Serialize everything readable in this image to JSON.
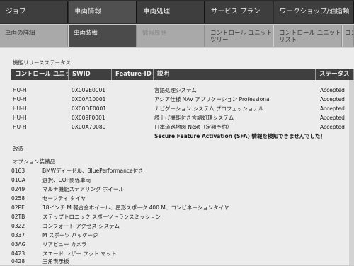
{
  "main_tabs": [
    {
      "label": "ジョブ"
    },
    {
      "label": "車両情報"
    },
    {
      "label": "車両処理"
    },
    {
      "label": "サービス プラン"
    },
    {
      "label": "ワークショップ/油脂類"
    }
  ],
  "sub_tabs": [
    {
      "label": "車両の詳細"
    },
    {
      "label": "車両装備"
    },
    {
      "label": "情報履歴"
    },
    {
      "label": "コントロール ユニット ツリー"
    },
    {
      "label": "コントロール ユニット リスト"
    },
    {
      "label": "コン"
    }
  ],
  "release_section": {
    "title": "機能リリースステータス"
  },
  "table": {
    "headers": {
      "unit": "コントロール ユニット",
      "swid": "SWID",
      "feature_id": "Feature-ID",
      "description": "説明",
      "status": "ステータス"
    },
    "rows": [
      {
        "unit": "HU-H",
        "swid": "0X009E0001",
        "description": "言語処理システム",
        "status": "Accepted"
      },
      {
        "unit": "HU-H",
        "swid": "0X00A10001",
        "description": "アジア仕様 NAV アプリケーション Professional",
        "status": "Accepted"
      },
      {
        "unit": "HU-H",
        "swid": "0X00DE0001",
        "description": "ナビゲーション システム プロフェッショナル",
        "status": "Accepted"
      },
      {
        "unit": "HU-H",
        "swid": "0X009F0001",
        "description": "読上げ機能付き言語処理システム",
        "status": "Accepted"
      },
      {
        "unit": "HU-H",
        "swid": "0X00A70080",
        "description": "日本道路地図 Next（定期予約）",
        "status": "Accepted"
      }
    ],
    "note": "Secure Feature Activation (SFA) 情報を検知できませんでした！"
  },
  "revision_label": "改造",
  "options": {
    "title": "オプション装備品",
    "items": [
      {
        "code": "0163",
        "name": "BMWディーゼル、BluePerformance付き"
      },
      {
        "code": "01CA",
        "name": "選択、COP関係車両"
      },
      {
        "code": "0249",
        "name": "マルチ機能ステアリング ホイール"
      },
      {
        "code": "0258",
        "name": "セーフティ タイヤ"
      },
      {
        "code": "02PE",
        "name": "18インチ M 軽合金ホイール、星形スポーク 400 M、コンビネーションタイヤ"
      },
      {
        "code": "02TB",
        "name": "ステップトロニック スポーツトランスミッション"
      },
      {
        "code": "0322",
        "name": "コンフォート アクセス システム"
      },
      {
        "code": "0337",
        "name": "M スポーツ パッケージ"
      },
      {
        "code": "03AG",
        "name": "リアビュー カメラ"
      },
      {
        "code": "0423",
        "name": "スエード レザー フット マット"
      },
      {
        "code": "0428",
        "name": "三角表示板"
      }
    ]
  }
}
